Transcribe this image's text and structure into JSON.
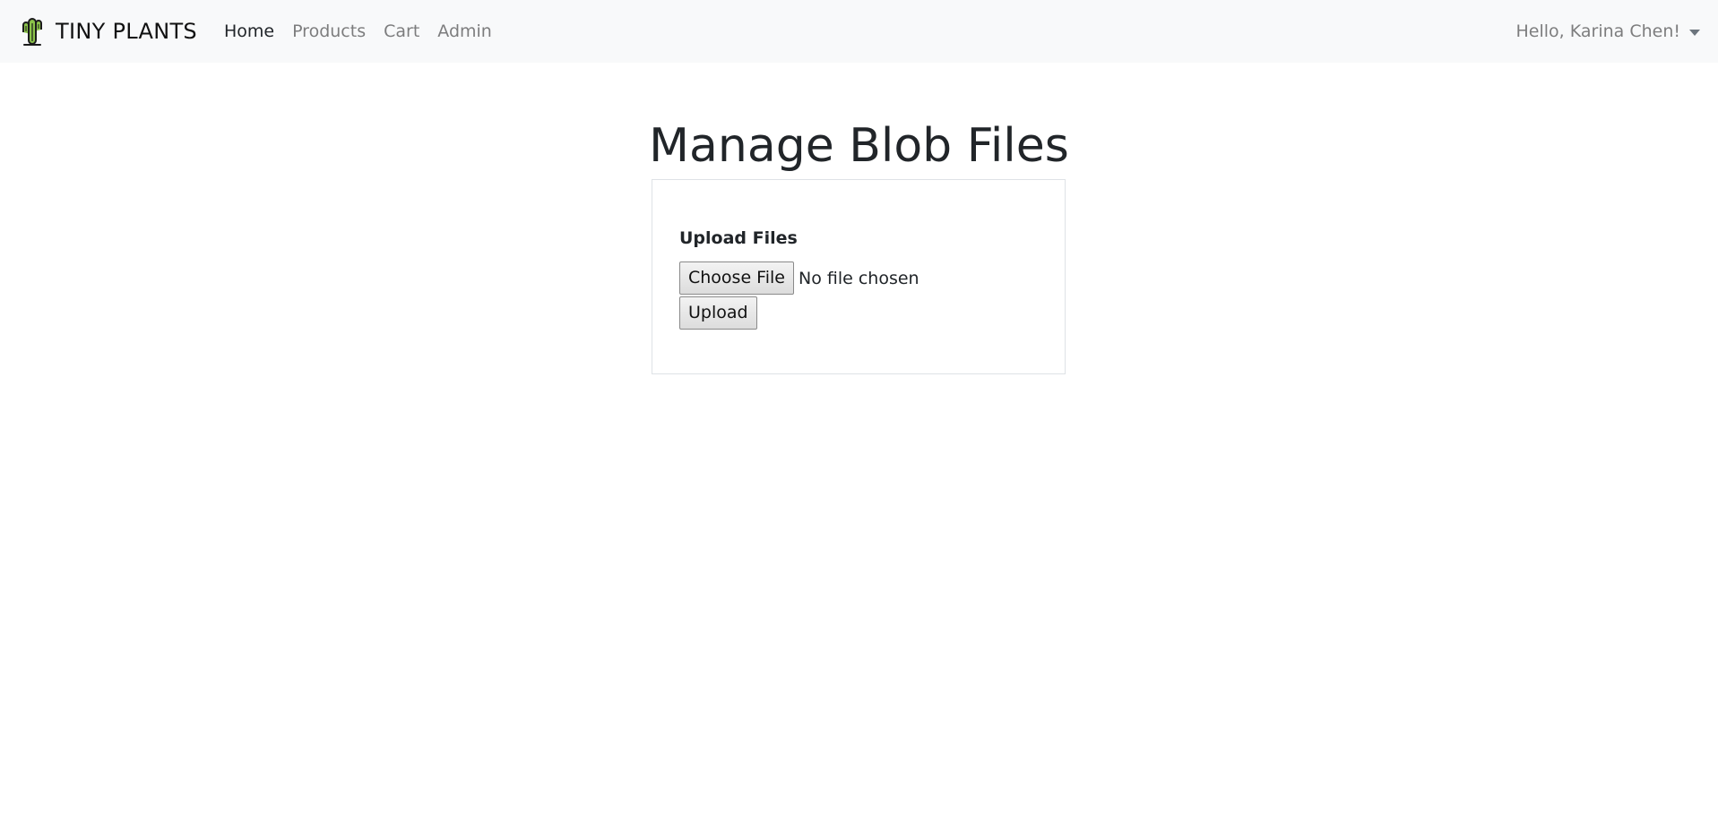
{
  "navbar": {
    "brand": {
      "icon": "cactus-icon",
      "label": "TINY PLANTS"
    },
    "links": [
      {
        "label": "Home",
        "active": true
      },
      {
        "label": "Products",
        "active": false
      },
      {
        "label": "Cart",
        "active": false
      },
      {
        "label": "Admin",
        "active": false
      }
    ],
    "user": {
      "label": "Hello, Karina Chen!",
      "icon": "caret-down-icon"
    }
  },
  "main": {
    "title": "Manage Blob Files",
    "upload_card": {
      "heading": "Upload Files",
      "choose_file_label": "Choose File",
      "file_status": "No file chosen",
      "upload_label": "Upload"
    }
  },
  "colors": {
    "navbar_bg": "#f8f9fa",
    "link_muted": "#808080",
    "link_active": "#212529",
    "card_border": "#dee2e6",
    "cactus_green": "#7cb342"
  }
}
